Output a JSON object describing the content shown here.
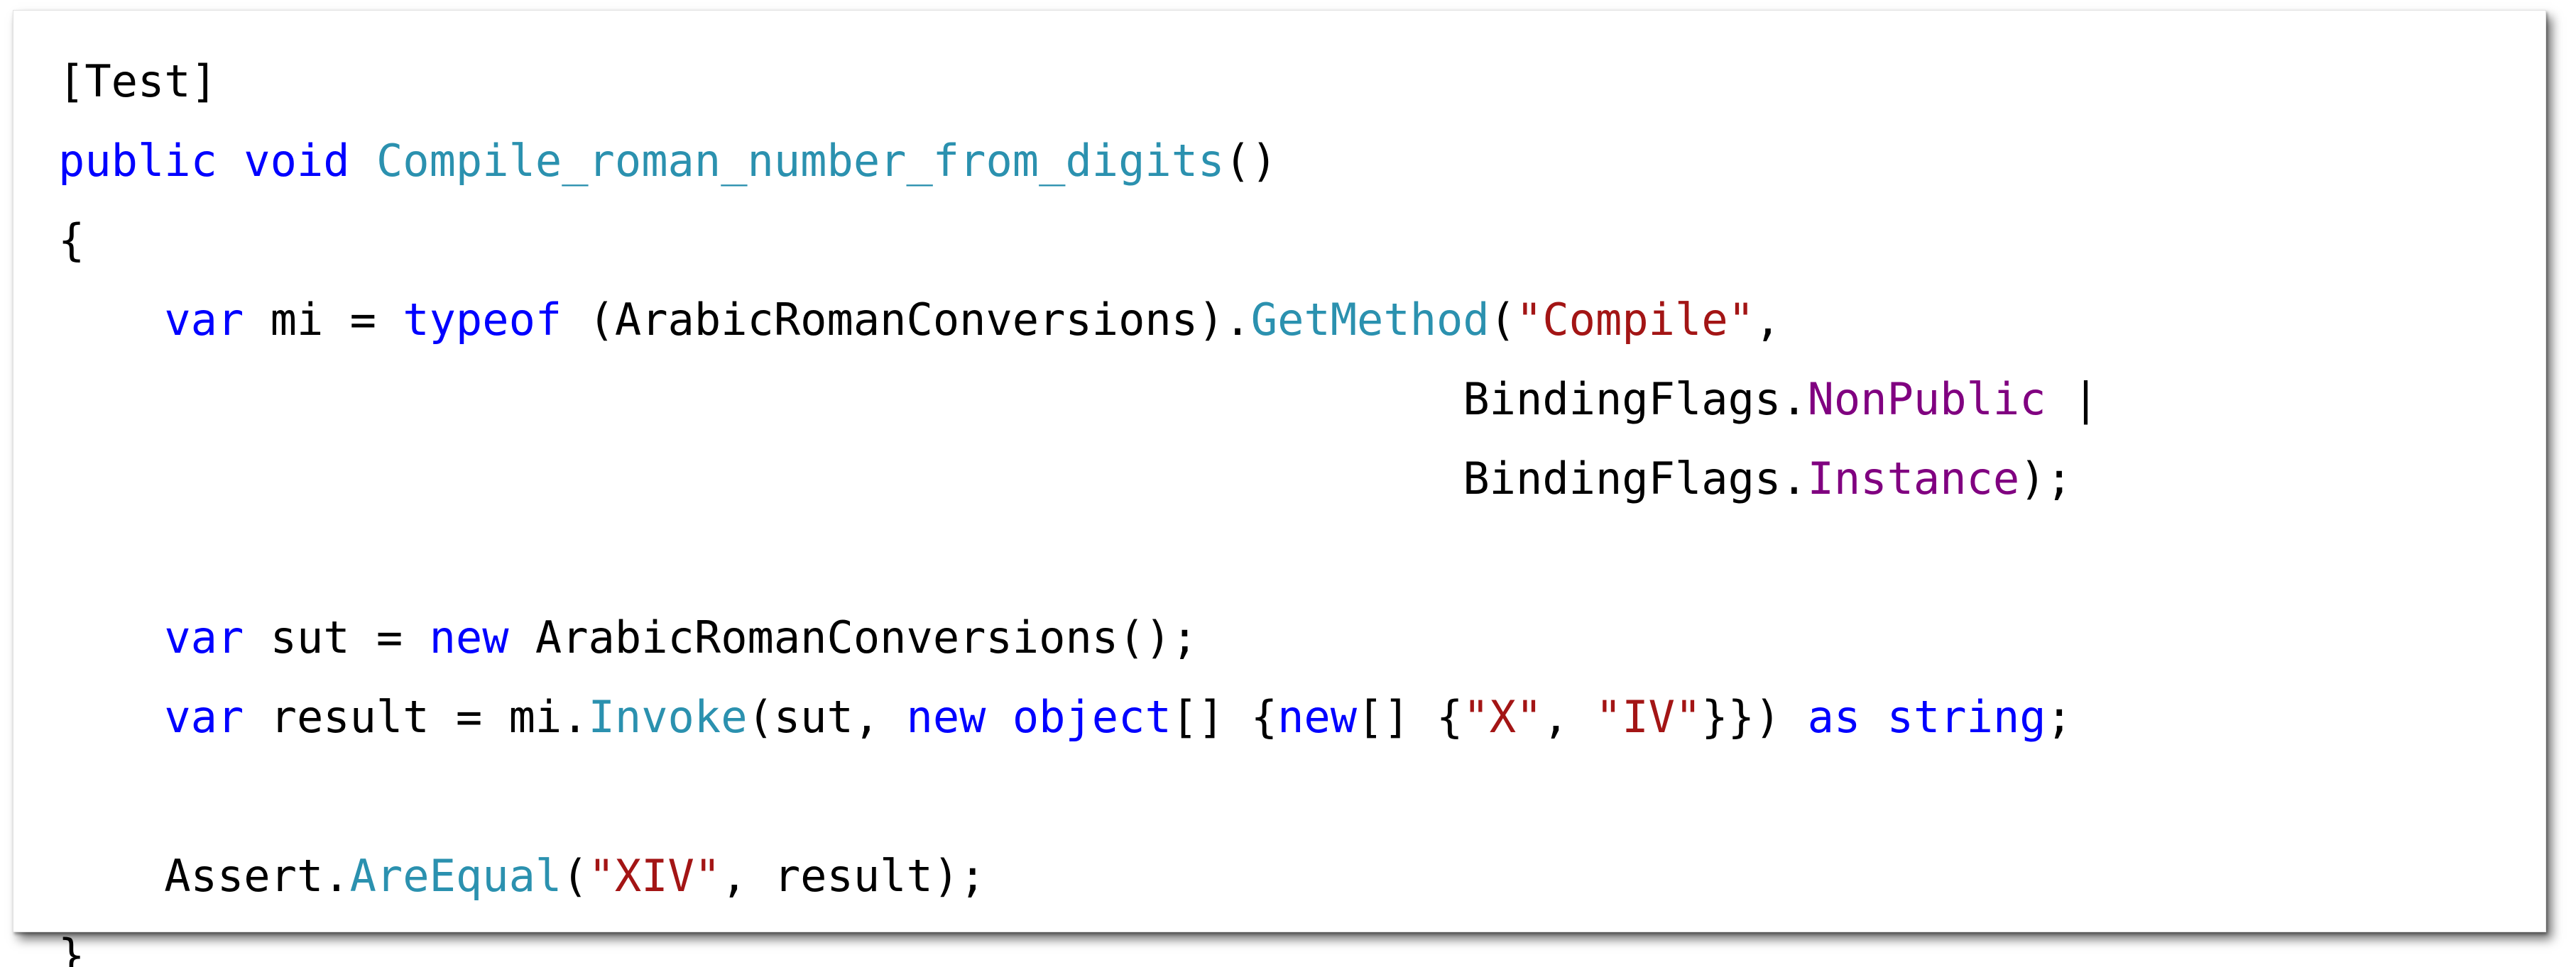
{
  "code_view": {
    "colors": {
      "keyword": "#0000ff",
      "type": "#2b91af",
      "string": "#a31515",
      "enum_member": "#800080",
      "plain": "#000000"
    },
    "lines": [
      [
        {
          "t": "[Test]",
          "c": "plain"
        }
      ],
      [
        {
          "t": "public",
          "c": "kw"
        },
        {
          "t": " ",
          "c": "plain"
        },
        {
          "t": "void",
          "c": "kw"
        },
        {
          "t": " ",
          "c": "plain"
        },
        {
          "t": "Compile_roman_number_from_digits",
          "c": "type"
        },
        {
          "t": "()",
          "c": "plain"
        }
      ],
      [
        {
          "t": "{",
          "c": "plain"
        }
      ],
      [
        {
          "t": "    ",
          "c": "plain"
        },
        {
          "t": "var",
          "c": "kw"
        },
        {
          "t": " mi = ",
          "c": "plain"
        },
        {
          "t": "typeof",
          "c": "kw"
        },
        {
          "t": " (ArabicRomanConversions).",
          "c": "plain"
        },
        {
          "t": "GetMethod",
          "c": "type"
        },
        {
          "t": "(",
          "c": "plain"
        },
        {
          "t": "\"Compile\"",
          "c": "str"
        },
        {
          "t": ",",
          "c": "plain"
        }
      ],
      [
        {
          "t": "                                                     BindingFlags.",
          "c": "plain"
        },
        {
          "t": "NonPublic",
          "c": "enum"
        },
        {
          "t": " |",
          "c": "plain"
        }
      ],
      [
        {
          "t": "                                                     BindingFlags.",
          "c": "plain"
        },
        {
          "t": "Instance",
          "c": "enum"
        },
        {
          "t": ");",
          "c": "plain"
        }
      ],
      [],
      [
        {
          "t": "    ",
          "c": "plain"
        },
        {
          "t": "var",
          "c": "kw"
        },
        {
          "t": " sut = ",
          "c": "plain"
        },
        {
          "t": "new",
          "c": "kw"
        },
        {
          "t": " ArabicRomanConversions();",
          "c": "plain"
        }
      ],
      [
        {
          "t": "    ",
          "c": "plain"
        },
        {
          "t": "var",
          "c": "kw"
        },
        {
          "t": " result = mi.",
          "c": "plain"
        },
        {
          "t": "Invoke",
          "c": "type"
        },
        {
          "t": "(sut, ",
          "c": "plain"
        },
        {
          "t": "new",
          "c": "kw"
        },
        {
          "t": " ",
          "c": "plain"
        },
        {
          "t": "object",
          "c": "kw"
        },
        {
          "t": "[] {",
          "c": "plain"
        },
        {
          "t": "new",
          "c": "kw"
        },
        {
          "t": "[] {",
          "c": "plain"
        },
        {
          "t": "\"X\"",
          "c": "str"
        },
        {
          "t": ", ",
          "c": "plain"
        },
        {
          "t": "\"IV\"",
          "c": "str"
        },
        {
          "t": "}}) ",
          "c": "plain"
        },
        {
          "t": "as",
          "c": "kw"
        },
        {
          "t": " ",
          "c": "plain"
        },
        {
          "t": "string",
          "c": "kw"
        },
        {
          "t": ";",
          "c": "plain"
        }
      ],
      [],
      [
        {
          "t": "    Assert.",
          "c": "plain"
        },
        {
          "t": "AreEqual",
          "c": "type"
        },
        {
          "t": "(",
          "c": "plain"
        },
        {
          "t": "\"XIV\"",
          "c": "str"
        },
        {
          "t": ", result);",
          "c": "plain"
        }
      ],
      [
        {
          "t": "}",
          "c": "plain"
        }
      ]
    ]
  }
}
